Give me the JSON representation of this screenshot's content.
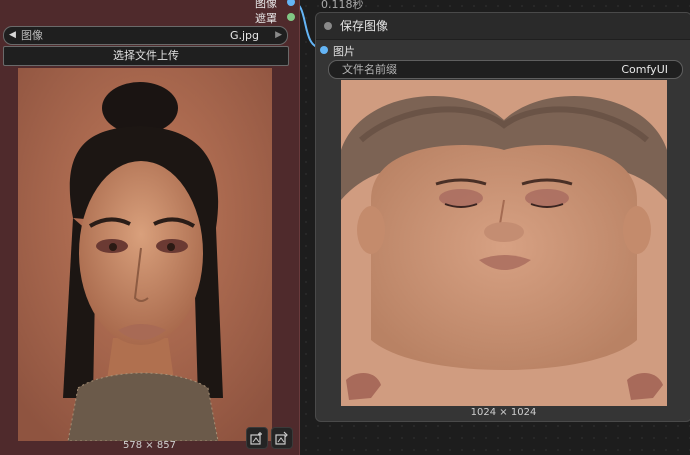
{
  "load_node": {
    "outputs": [
      {
        "label": "图像",
        "color": "#64b5f6"
      },
      {
        "label": "遮罩",
        "color": "#81c784"
      }
    ],
    "image_widget": {
      "name": "图像",
      "value": "G.jpg"
    },
    "upload_label": "选择文件上传",
    "dimensions": "578 × 857"
  },
  "save_node": {
    "time": "0.118秒",
    "title": "保存图像",
    "input_label": "图片",
    "prefix_widget": {
      "name": "文件名前缀",
      "value": "ComfyUI"
    },
    "dimensions": "1024 × 1024"
  },
  "colors": {
    "load_node_bg": "#4f2a2c",
    "save_node_bg": "#353535",
    "wire": "#64b5f6"
  }
}
